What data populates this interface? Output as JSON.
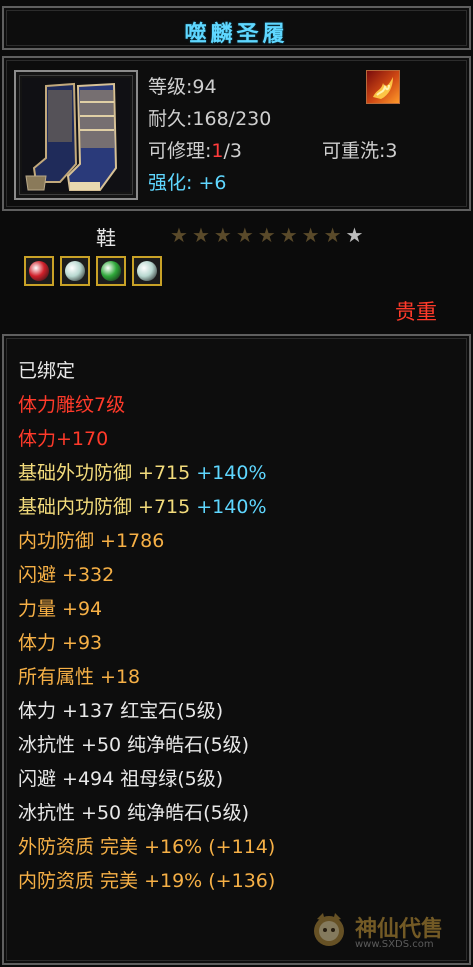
{
  "item": {
    "name": "噬麟圣履",
    "level_label": "等级:",
    "level": "94",
    "durability_label": "耐久:",
    "durability": "168/230",
    "repair_label": "可修理:",
    "repair_used": "1",
    "repair_total": "/3",
    "rewash_label": "可重洗:",
    "rewash": "3",
    "enhance_label": "强化:",
    "enhance": "+6",
    "slot": "鞋",
    "rarity": "贵重",
    "stars_filled": 8,
    "stars_total": 9,
    "icon": "boots-icon",
    "badge_icon": "flame-emblem-icon"
  },
  "gems": [
    {
      "name": "red-gem",
      "color": "#d0202a"
    },
    {
      "name": "white-gem",
      "color": "#b8d8d0"
    },
    {
      "name": "green-gem",
      "color": "#2fa83a"
    },
    {
      "name": "white-gem",
      "color": "#b8d8d0"
    }
  ],
  "colors": {
    "title": "#5fd7ff",
    "red": "#ff3a2a",
    "yellow": "#f3dc7c",
    "orange": "#f6b046",
    "cyan": "#5fd7ff",
    "white": "#e8e8e8"
  },
  "attributes": [
    {
      "text": "已绑定",
      "color": "white"
    },
    {
      "text": "体力雕纹7级",
      "color": "red"
    },
    {
      "text": "体力+170",
      "color": "red"
    },
    {
      "text": "基础外功防御 +715 ",
      "extra": "+140%",
      "color": "yellow"
    },
    {
      "text": "基础内功防御 +715 ",
      "extra": "+140%",
      "color": "yellow"
    },
    {
      "text": "内功防御 +1786",
      "color": "orange"
    },
    {
      "text": "闪避 +332",
      "color": "orange"
    },
    {
      "text": "力量 +94",
      "color": "orange"
    },
    {
      "text": "体力 +93",
      "color": "orange"
    },
    {
      "text": "所有属性 +18",
      "color": "orange"
    },
    {
      "text": "体力 +137 红宝石(5级)",
      "color": "white"
    },
    {
      "text": "冰抗性 +50 纯净皓石(5级)",
      "color": "white"
    },
    {
      "text": "闪避 +494 祖母绿(5级)",
      "color": "white"
    },
    {
      "text": "冰抗性 +50 纯净皓石(5级)",
      "color": "white"
    },
    {
      "text": "外防资质  完美 +16% (+114)",
      "color": "orange"
    },
    {
      "text": "内防资质  完美 +19% (+136)",
      "color": "orange"
    }
  ],
  "watermark": {
    "text": "神仙代售",
    "url": "www.SXDS.com",
    "icon": "mascot-logo-icon"
  }
}
